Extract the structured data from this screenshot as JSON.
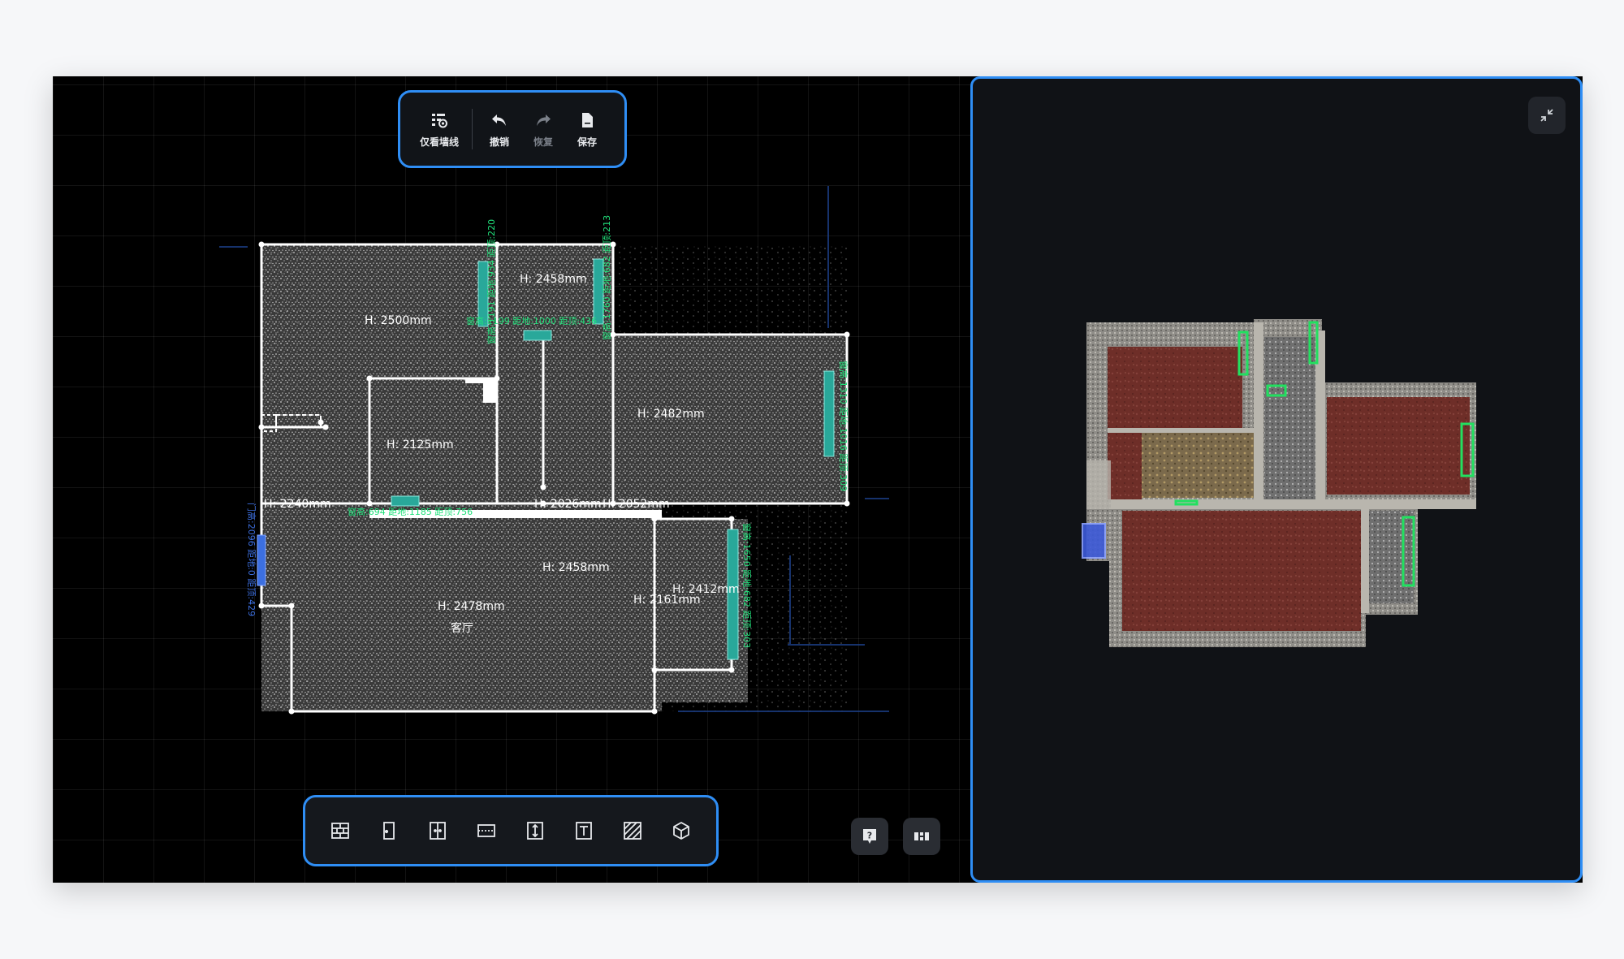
{
  "toolbar": {
    "view_walls_label": "仅看墙线",
    "undo_label": "撤销",
    "redo_label": "恢复",
    "save_label": "保存"
  },
  "tools": [
    {
      "icon": "wall-grid-icon"
    },
    {
      "icon": "door-icon"
    },
    {
      "icon": "double-door-icon"
    },
    {
      "icon": "window-icon"
    },
    {
      "icon": "height-measure-icon"
    },
    {
      "icon": "text-icon"
    },
    {
      "icon": "hatch-area-icon"
    },
    {
      "icon": "cube-3d-icon"
    }
  ],
  "floor_plan": {
    "room_heights": {
      "top_left": "H: 2500mm",
      "top_middle": "H: 2458mm",
      "inner_small": "H: 2125mm",
      "right": "H: 2482mm",
      "left_small": "H: 2240mm",
      "corridor": "H: 2026mm",
      "corridor_right": "H: 2052mm",
      "living_center": "H: 2458mm",
      "living": "H: 2478mm",
      "balcony_left": "H: 2161mm",
      "balcony": "H: 2412mm"
    },
    "living_room_name": "客厅",
    "openings": {
      "w_top_mid_horizontal": "窗高:1199 距地:1000 距顶:436",
      "w_top_left_vertical": "窗高:1191 距地:934 距顶:220",
      "w_top_right_vertical": "窗高:1760 距地:682 距顶:213",
      "w_right_vertical": "窗高:1310 距地:1016 距顶:309",
      "w_bottom_horizontal": "窗高:694 距地:1185 距顶:756",
      "w_balcony_vertical": "窗高:1650 距地:682 距顶:303",
      "door_left_vertical": "门高:2096 距地:0 距顶:429"
    }
  },
  "colors": {
    "accent": "#2f8ef5",
    "annotation_green": "#20e07a",
    "window_teal": "#29a89a",
    "door_blue": "#3c6fe0",
    "wall": "#ffffff",
    "floor_3d": "#6e2e28"
  }
}
